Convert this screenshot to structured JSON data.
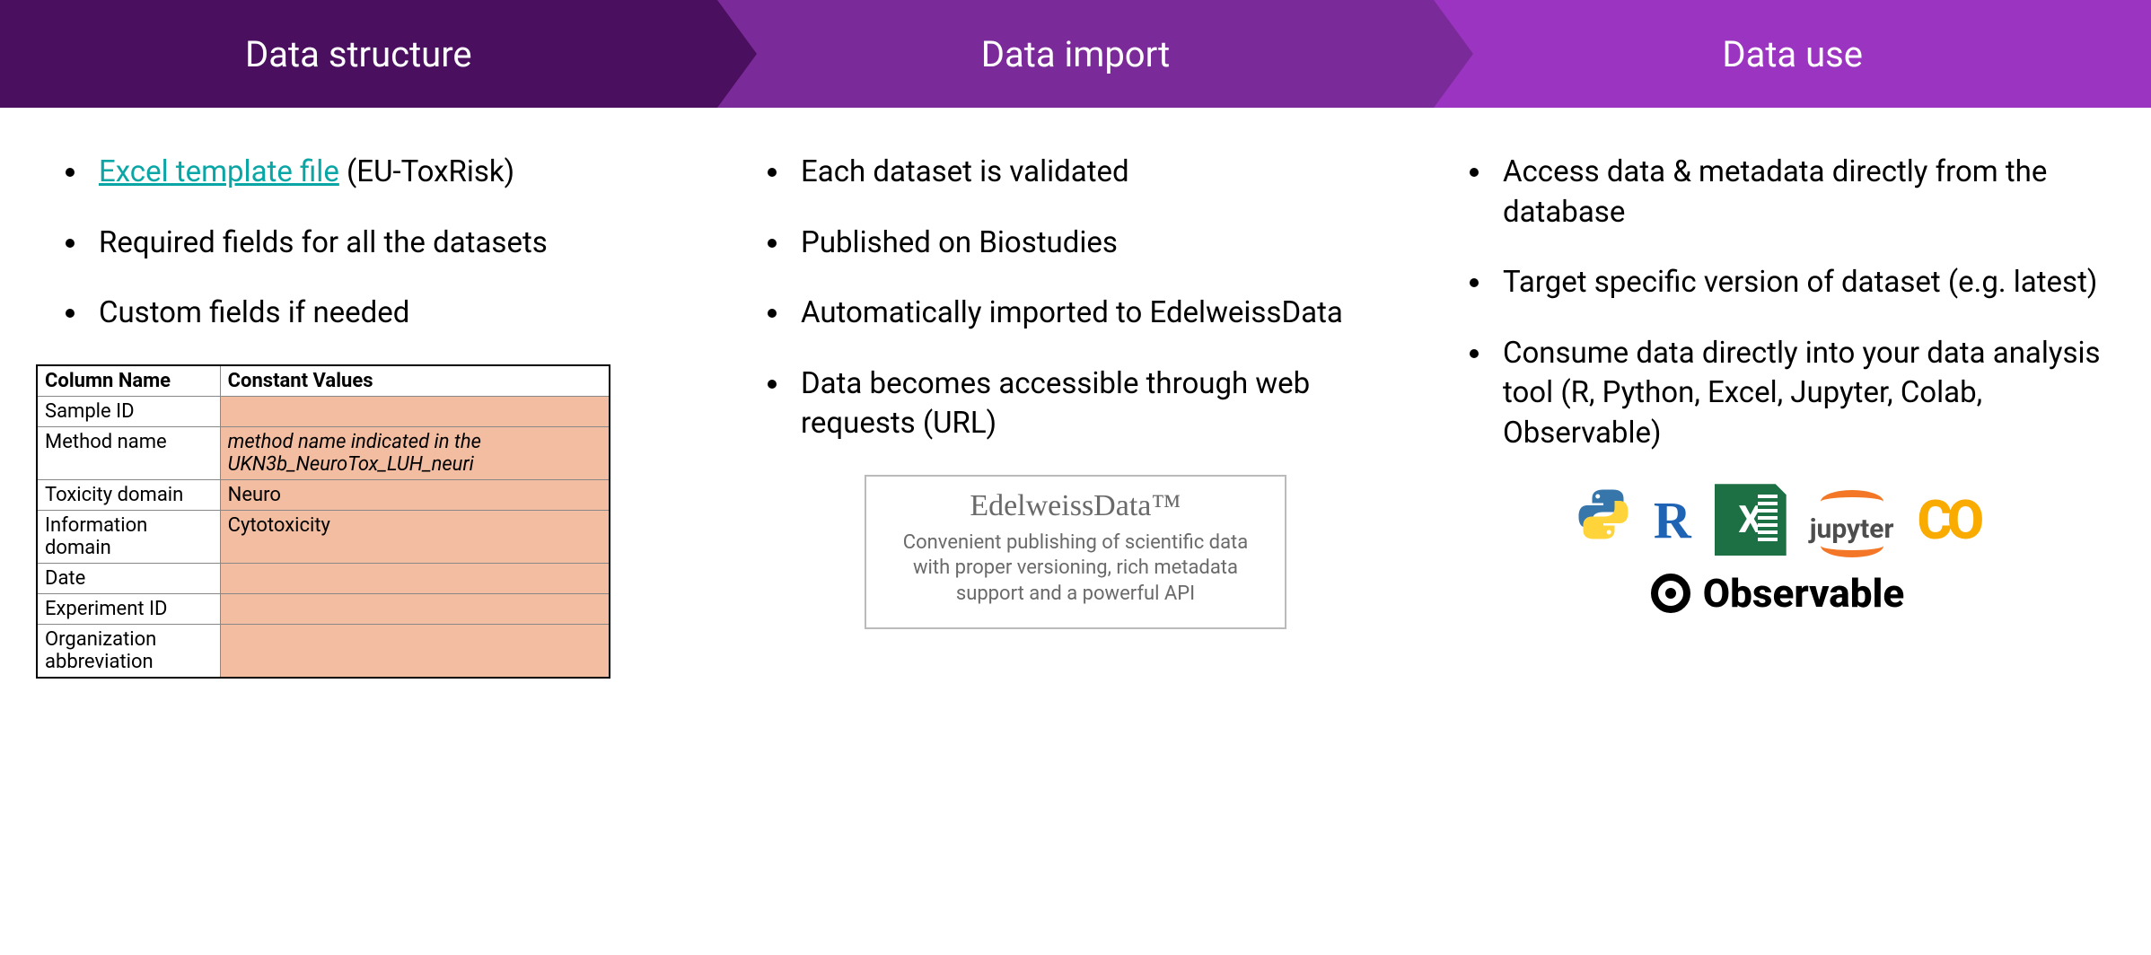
{
  "arrows": [
    "Data structure",
    "Data import",
    "Data use"
  ],
  "col1": {
    "link_text": "Excel template file",
    "link_suffix": " (EU-ToxRisk)",
    "bullets_rest": [
      "Required fields for all the datasets",
      "Custom fields if needed"
    ],
    "table": {
      "headers": [
        "Column Name",
        "Constant Values"
      ],
      "rows": [
        {
          "name": "Sample ID",
          "value": ""
        },
        {
          "name": "Method name",
          "value": "method name indicated in the UKN3b_NeuroTox_LUH_neuri",
          "italic": true
        },
        {
          "name": "Toxicity domain",
          "value": "Neuro"
        },
        {
          "name": "Information domain",
          "value": "Cytotoxicity"
        },
        {
          "name": "Date",
          "value": ""
        },
        {
          "name": "Experiment ID",
          "value": ""
        },
        {
          "name": "Organization abbreviation",
          "value": ""
        }
      ]
    }
  },
  "col2": {
    "bullets": [
      "Each dataset is validated",
      "Published on Biostudies",
      "Automatically imported to EdelweissData",
      "Data becomes accessible through web requests (URL)"
    ],
    "ed_title": "EdelweissData™",
    "ed_desc": "Convenient publishing of scientific data with proper versioning, rich metadata support and a powerful API"
  },
  "col3": {
    "bullets": [
      "Access data & metadata directly from the database",
      "Target specific version of dataset (e.g. latest)",
      "Consume data directly into your data analysis tool (R, Python, Excel, Jupyter, Colab, Observable)"
    ],
    "logos": {
      "r": "R",
      "excel": "X",
      "jupyter": "jupyter",
      "colab": "CO",
      "observable": "Observable"
    }
  }
}
